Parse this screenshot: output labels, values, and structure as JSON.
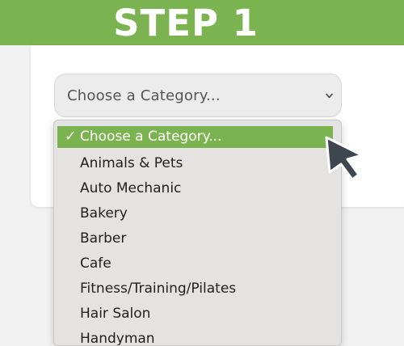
{
  "banner": {
    "title": "STEP 1"
  },
  "category_select": {
    "selected_value": "Choose a Category...",
    "options": [
      "Choose a Category...",
      "Animals & Pets",
      "Auto Mechanic",
      "Bakery",
      "Barber",
      "Cafe",
      "Fitness/Training/Pilates",
      "Hair Salon",
      "Handyman"
    ],
    "selected_check_glyph": "✓"
  },
  "icons": {
    "chevron": "chevron-down-icon",
    "cursor": "mouse-pointer-icon",
    "check": "checkmark-icon"
  },
  "colors": {
    "banner": "#7ab34f",
    "highlight": "#7ab34f",
    "cursor": "#3e4650",
    "dropdown_bg": "#e4e3e2",
    "select_bg": "#ececec"
  }
}
